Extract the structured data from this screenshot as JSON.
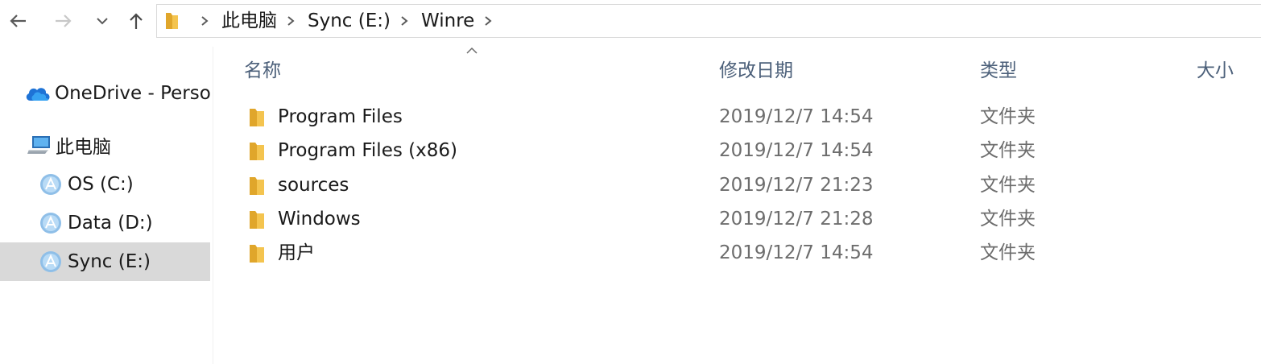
{
  "toolbar": {
    "back_icon": "back-arrow-icon",
    "forward_icon": "forward-arrow-icon",
    "recent_icon": "chevron-down-icon",
    "up_icon": "up-arrow-icon"
  },
  "address_bar": {
    "icon": "folder-icon",
    "breadcrumbs": [
      "此电脑",
      "Sync (E:)",
      "Winre"
    ]
  },
  "sidebar": {
    "items": [
      {
        "label": "OneDrive - Personal",
        "icon": "onedrive-cloud-icon"
      },
      {
        "label": "此电脑",
        "icon": "computer-icon"
      },
      {
        "label": "OS (C:)",
        "icon": "drive-icon"
      },
      {
        "label": "Data (D:)",
        "icon": "drive-icon"
      },
      {
        "label": "Sync (E:)",
        "icon": "drive-icon",
        "selected": true
      }
    ]
  },
  "columns": {
    "name": "名称",
    "modified": "修改日期",
    "type": "类型",
    "size": "大小",
    "sort_icon": "sort-ascending-icon"
  },
  "files": [
    {
      "name": "Program Files",
      "modified": "2019/12/7 14:54",
      "type": "文件夹",
      "icon": "folder-icon"
    },
    {
      "name": "Program Files (x86)",
      "modified": "2019/12/7 14:54",
      "type": "文件夹",
      "icon": "folder-icon"
    },
    {
      "name": "sources",
      "modified": "2019/12/7 21:23",
      "type": "文件夹",
      "icon": "folder-icon"
    },
    {
      "name": "Windows",
      "modified": "2019/12/7 21:28",
      "type": "文件夹",
      "icon": "folder-icon"
    },
    {
      "name": "用户",
      "modified": "2019/12/7 14:54",
      "type": "文件夹",
      "icon": "folder-icon"
    }
  ],
  "colors": {
    "selection": "#d9d9d9",
    "header_text": "#4c607a",
    "folder_yellow": "#f4c44f"
  }
}
